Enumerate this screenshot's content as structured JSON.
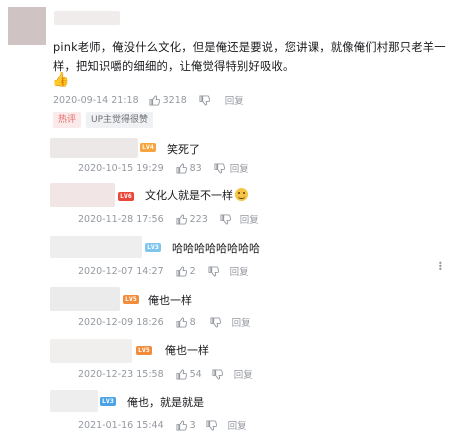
{
  "main_comment": {
    "text": "pink老师，俺没什么文化，但是俺还是要说，您讲课，就像俺们村那只老羊一样，把知识嚼的细细的，让俺觉得特别好吸收。",
    "emoji_label": "👍",
    "date": "2020-09-14 21:18",
    "likes": "3218",
    "reply_label": "回复",
    "tags": [
      "热评",
      "UP主觉得很赞"
    ]
  },
  "replies": [
    {
      "level": "LV4",
      "level_color": "#f6a43b",
      "text": "笑死了",
      "date": "2020-10-15 19:29",
      "likes": "83",
      "reply_label": "回复"
    },
    {
      "level": "LV6",
      "level_color": "#e9473a",
      "text": "文化人就是不一样",
      "date": "2020-11-28 17:56",
      "likes": "223",
      "reply_label": "回复"
    },
    {
      "level": "LV3",
      "level_color": "#7fc6ef",
      "text": "哈哈哈哈哈哈哈哈",
      "date": "2020-12-07 14:27",
      "likes": "2",
      "reply_label": "回复"
    },
    {
      "level": "LV5",
      "level_color": "#f28b3a",
      "text": "俺也一样",
      "date": "2020-12-09 18:26",
      "likes": "8",
      "reply_label": "回复"
    },
    {
      "level": "LV5",
      "level_color": "#f28b3a",
      "text": "俺也一样",
      "date": "2020-12-23 15:58",
      "likes": "54",
      "reply_label": "回复"
    },
    {
      "level": "LV3",
      "level_color": "#4aa3e6",
      "text": "俺也，就是就是",
      "date": "2021-01-16 15:44",
      "likes": "3",
      "reply_label": "回复"
    }
  ],
  "icons": {
    "like": "thumbs-up-icon",
    "dislike": "thumbs-down-icon",
    "reply": "reply-icon",
    "more": "more-vertical-icon"
  }
}
